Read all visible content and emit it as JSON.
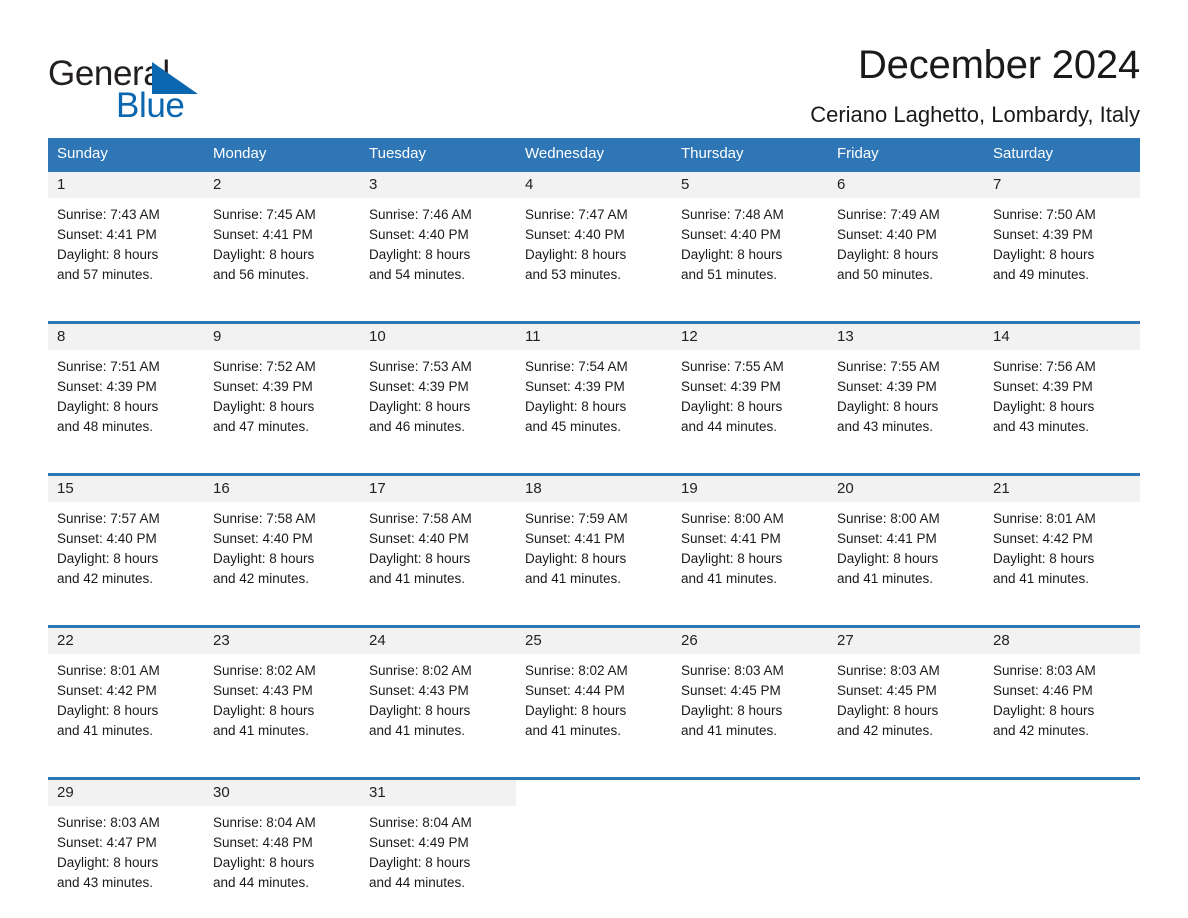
{
  "brand": {
    "name_part1": "General",
    "name_part2": "Blue",
    "triangle_color": "#0b68b0",
    "accent_color": "#2e76b6"
  },
  "header": {
    "title": "December 2024",
    "subtitle": "Ceriano Laghetto, Lombardy, Italy"
  },
  "calendar": {
    "day_headers": [
      "Sunday",
      "Monday",
      "Tuesday",
      "Wednesday",
      "Thursday",
      "Friday",
      "Saturday"
    ],
    "header_bg": "#2e76b6",
    "daynum_bg": "#f2f2f2",
    "weeks": [
      {
        "days": [
          {
            "num": "1",
            "sunrise": "Sunrise: 7:43 AM",
            "sunset": "Sunset: 4:41 PM",
            "daylight1": "Daylight: 8 hours",
            "daylight2": "and 57 minutes."
          },
          {
            "num": "2",
            "sunrise": "Sunrise: 7:45 AM",
            "sunset": "Sunset: 4:41 PM",
            "daylight1": "Daylight: 8 hours",
            "daylight2": "and 56 minutes."
          },
          {
            "num": "3",
            "sunrise": "Sunrise: 7:46 AM",
            "sunset": "Sunset: 4:40 PM",
            "daylight1": "Daylight: 8 hours",
            "daylight2": "and 54 minutes."
          },
          {
            "num": "4",
            "sunrise": "Sunrise: 7:47 AM",
            "sunset": "Sunset: 4:40 PM",
            "daylight1": "Daylight: 8 hours",
            "daylight2": "and 53 minutes."
          },
          {
            "num": "5",
            "sunrise": "Sunrise: 7:48 AM",
            "sunset": "Sunset: 4:40 PM",
            "daylight1": "Daylight: 8 hours",
            "daylight2": "and 51 minutes."
          },
          {
            "num": "6",
            "sunrise": "Sunrise: 7:49 AM",
            "sunset": "Sunset: 4:40 PM",
            "daylight1": "Daylight: 8 hours",
            "daylight2": "and 50 minutes."
          },
          {
            "num": "7",
            "sunrise": "Sunrise: 7:50 AM",
            "sunset": "Sunset: 4:39 PM",
            "daylight1": "Daylight: 8 hours",
            "daylight2": "and 49 minutes."
          }
        ]
      },
      {
        "days": [
          {
            "num": "8",
            "sunrise": "Sunrise: 7:51 AM",
            "sunset": "Sunset: 4:39 PM",
            "daylight1": "Daylight: 8 hours",
            "daylight2": "and 48 minutes."
          },
          {
            "num": "9",
            "sunrise": "Sunrise: 7:52 AM",
            "sunset": "Sunset: 4:39 PM",
            "daylight1": "Daylight: 8 hours",
            "daylight2": "and 47 minutes."
          },
          {
            "num": "10",
            "sunrise": "Sunrise: 7:53 AM",
            "sunset": "Sunset: 4:39 PM",
            "daylight1": "Daylight: 8 hours",
            "daylight2": "and 46 minutes."
          },
          {
            "num": "11",
            "sunrise": "Sunrise: 7:54 AM",
            "sunset": "Sunset: 4:39 PM",
            "daylight1": "Daylight: 8 hours",
            "daylight2": "and 45 minutes."
          },
          {
            "num": "12",
            "sunrise": "Sunrise: 7:55 AM",
            "sunset": "Sunset: 4:39 PM",
            "daylight1": "Daylight: 8 hours",
            "daylight2": "and 44 minutes."
          },
          {
            "num": "13",
            "sunrise": "Sunrise: 7:55 AM",
            "sunset": "Sunset: 4:39 PM",
            "daylight1": "Daylight: 8 hours",
            "daylight2": "and 43 minutes."
          },
          {
            "num": "14",
            "sunrise": "Sunrise: 7:56 AM",
            "sunset": "Sunset: 4:39 PM",
            "daylight1": "Daylight: 8 hours",
            "daylight2": "and 43 minutes."
          }
        ]
      },
      {
        "days": [
          {
            "num": "15",
            "sunrise": "Sunrise: 7:57 AM",
            "sunset": "Sunset: 4:40 PM",
            "daylight1": "Daylight: 8 hours",
            "daylight2": "and 42 minutes."
          },
          {
            "num": "16",
            "sunrise": "Sunrise: 7:58 AM",
            "sunset": "Sunset: 4:40 PM",
            "daylight1": "Daylight: 8 hours",
            "daylight2": "and 42 minutes."
          },
          {
            "num": "17",
            "sunrise": "Sunrise: 7:58 AM",
            "sunset": "Sunset: 4:40 PM",
            "daylight1": "Daylight: 8 hours",
            "daylight2": "and 41 minutes."
          },
          {
            "num": "18",
            "sunrise": "Sunrise: 7:59 AM",
            "sunset": "Sunset: 4:41 PM",
            "daylight1": "Daylight: 8 hours",
            "daylight2": "and 41 minutes."
          },
          {
            "num": "19",
            "sunrise": "Sunrise: 8:00 AM",
            "sunset": "Sunset: 4:41 PM",
            "daylight1": "Daylight: 8 hours",
            "daylight2": "and 41 minutes."
          },
          {
            "num": "20",
            "sunrise": "Sunrise: 8:00 AM",
            "sunset": "Sunset: 4:41 PM",
            "daylight1": "Daylight: 8 hours",
            "daylight2": "and 41 minutes."
          },
          {
            "num": "21",
            "sunrise": "Sunrise: 8:01 AM",
            "sunset": "Sunset: 4:42 PM",
            "daylight1": "Daylight: 8 hours",
            "daylight2": "and 41 minutes."
          }
        ]
      },
      {
        "days": [
          {
            "num": "22",
            "sunrise": "Sunrise: 8:01 AM",
            "sunset": "Sunset: 4:42 PM",
            "daylight1": "Daylight: 8 hours",
            "daylight2": "and 41 minutes."
          },
          {
            "num": "23",
            "sunrise": "Sunrise: 8:02 AM",
            "sunset": "Sunset: 4:43 PM",
            "daylight1": "Daylight: 8 hours",
            "daylight2": "and 41 minutes."
          },
          {
            "num": "24",
            "sunrise": "Sunrise: 8:02 AM",
            "sunset": "Sunset: 4:43 PM",
            "daylight1": "Daylight: 8 hours",
            "daylight2": "and 41 minutes."
          },
          {
            "num": "25",
            "sunrise": "Sunrise: 8:02 AM",
            "sunset": "Sunset: 4:44 PM",
            "daylight1": "Daylight: 8 hours",
            "daylight2": "and 41 minutes."
          },
          {
            "num": "26",
            "sunrise": "Sunrise: 8:03 AM",
            "sunset": "Sunset: 4:45 PM",
            "daylight1": "Daylight: 8 hours",
            "daylight2": "and 41 minutes."
          },
          {
            "num": "27",
            "sunrise": "Sunrise: 8:03 AM",
            "sunset": "Sunset: 4:45 PM",
            "daylight1": "Daylight: 8 hours",
            "daylight2": "and 42 minutes."
          },
          {
            "num": "28",
            "sunrise": "Sunrise: 8:03 AM",
            "sunset": "Sunset: 4:46 PM",
            "daylight1": "Daylight: 8 hours",
            "daylight2": "and 42 minutes."
          }
        ]
      },
      {
        "days": [
          {
            "num": "29",
            "sunrise": "Sunrise: 8:03 AM",
            "sunset": "Sunset: 4:47 PM",
            "daylight1": "Daylight: 8 hours",
            "daylight2": "and 43 minutes."
          },
          {
            "num": "30",
            "sunrise": "Sunrise: 8:04 AM",
            "sunset": "Sunset: 4:48 PM",
            "daylight1": "Daylight: 8 hours",
            "daylight2": "and 44 minutes."
          },
          {
            "num": "31",
            "sunrise": "Sunrise: 8:04 AM",
            "sunset": "Sunset: 4:49 PM",
            "daylight1": "Daylight: 8 hours",
            "daylight2": "and 44 minutes."
          },
          {
            "num": "",
            "sunrise": "",
            "sunset": "",
            "daylight1": "",
            "daylight2": ""
          },
          {
            "num": "",
            "sunrise": "",
            "sunset": "",
            "daylight1": "",
            "daylight2": ""
          },
          {
            "num": "",
            "sunrise": "",
            "sunset": "",
            "daylight1": "",
            "daylight2": ""
          },
          {
            "num": "",
            "sunrise": "",
            "sunset": "",
            "daylight1": "",
            "daylight2": ""
          }
        ]
      }
    ]
  }
}
